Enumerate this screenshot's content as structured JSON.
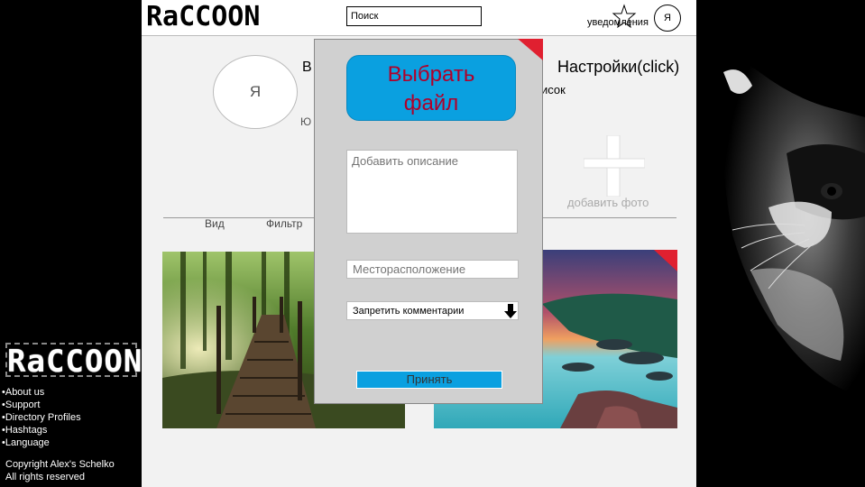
{
  "header": {
    "brand": "RaCCOON",
    "search_placeholder": "Поиск",
    "notifications_label": "уведомления",
    "user_avatar_letter": "Я"
  },
  "profile": {
    "avatar_letter": "Я",
    "name_visible": "В",
    "subtitle_visible": "Ю",
    "settings_link": "Настройки(click)",
    "list_label_visible": "исок",
    "add_photo_label": "добавить фото"
  },
  "tabs": {
    "view": "Вид",
    "filter": "Фильтр"
  },
  "modal": {
    "choose_file_label_line1": "Выбрать",
    "choose_file_label_line2": "файл",
    "description_placeholder": "Добавить описание",
    "location_placeholder": "Месторасположение",
    "comments_select_value": "Запретить комментарии",
    "accept_label": "Принять"
  },
  "sidebar": {
    "logo": "RaCCOON",
    "links": [
      "•About us",
      "•Support",
      "•Directory Profiles",
      "•Hashtags",
      "•Language"
    ],
    "copyright_line1": "Copyright Alex's Schelko",
    "copyright_line2": "All rights reserved"
  },
  "colors": {
    "accent_blue": "#0aa0e0",
    "choose_file_text": "#b0002a",
    "close_red": "#e02030",
    "page_bg": "#f2f2f2"
  }
}
